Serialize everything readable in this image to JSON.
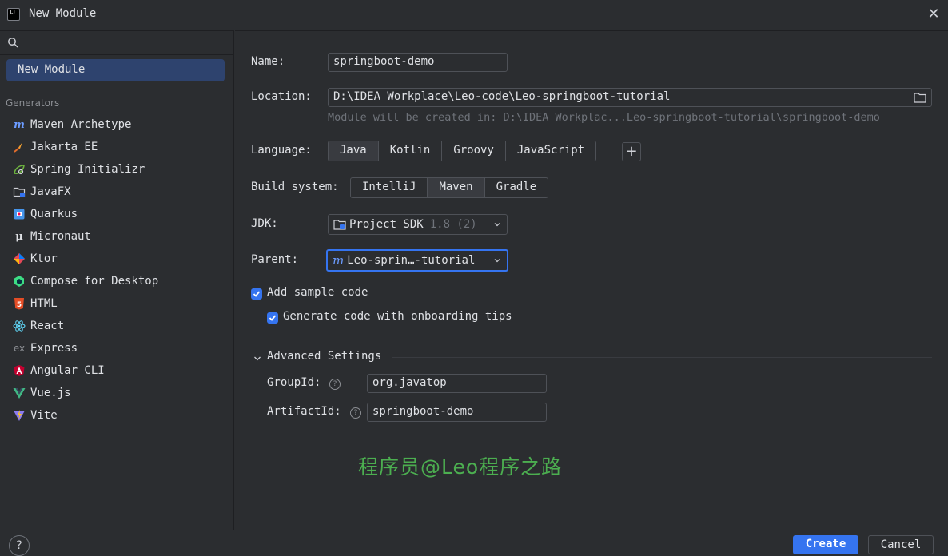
{
  "window": {
    "title": "New Module",
    "logo_text": "IJ"
  },
  "sidebar": {
    "selected": "New Module",
    "section_label": "Generators",
    "items": [
      {
        "label": "Maven Archetype",
        "icon": "maven-icon"
      },
      {
        "label": "Jakarta EE",
        "icon": "jakarta-ee-icon"
      },
      {
        "label": "Spring Initializr",
        "icon": "spring-icon"
      },
      {
        "label": "JavaFX",
        "icon": "javafx-icon"
      },
      {
        "label": "Quarkus",
        "icon": "quarkus-icon"
      },
      {
        "label": "Micronaut",
        "icon": "micronaut-icon"
      },
      {
        "label": "Ktor",
        "icon": "ktor-icon"
      },
      {
        "label": "Compose for Desktop",
        "icon": "compose-icon"
      },
      {
        "label": "HTML",
        "icon": "html-icon"
      },
      {
        "label": "React",
        "icon": "react-icon"
      },
      {
        "label": "Express",
        "icon": "express-icon"
      },
      {
        "label": "Angular CLI",
        "icon": "angular-icon"
      },
      {
        "label": "Vue.js",
        "icon": "vue-icon"
      },
      {
        "label": "Vite",
        "icon": "vite-icon"
      }
    ]
  },
  "form": {
    "name_label": "Name:",
    "name_value": "springboot-demo",
    "location_label": "Location:",
    "location_value": "D:\\IDEA Workplace\\Leo-code\\Leo-springboot-tutorial",
    "location_hint": "Module will be created in: D:\\IDEA Workplac...Leo-springboot-tutorial\\springboot-demo",
    "language_label": "Language:",
    "languages": [
      "Java",
      "Kotlin",
      "Groovy",
      "JavaScript"
    ],
    "language_selected": "Java",
    "build_label": "Build system:",
    "builds": [
      "IntelliJ",
      "Maven",
      "Gradle"
    ],
    "build_selected": "Maven",
    "jdk_label": "JDK:",
    "jdk_value": "Project SDK",
    "jdk_version": "1.8 (2)",
    "parent_label": "Parent:",
    "parent_value": "Leo-sprin…-tutorial",
    "sample_code_label": "Add sample code",
    "sample_code_checked": true,
    "onboarding_label": "Generate code with onboarding tips",
    "onboarding_checked": true,
    "advanced_label": "Advanced Settings",
    "groupid_label": "GroupId:",
    "groupid_value": "org.javatop",
    "artifactid_label": "ArtifactId:",
    "artifactid_value": "springboot-demo",
    "help_glyph": "?"
  },
  "watermark": "程序员@Leo程序之路",
  "footer": {
    "help": "?",
    "create": "Create",
    "cancel": "Cancel"
  },
  "colors": {
    "accent": "#3574f0",
    "selection": "#2e436e",
    "watermark": "#4caf50"
  }
}
